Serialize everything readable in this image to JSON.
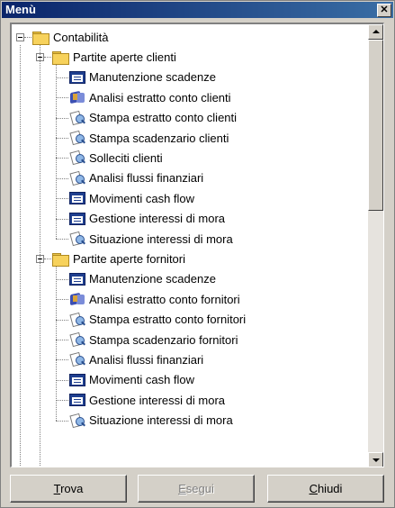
{
  "window": {
    "title": "Menù",
    "close_glyph": "✕"
  },
  "tree": {
    "root": {
      "label": "Contabilità",
      "icon": "folder-icon"
    },
    "groups": [
      {
        "label": "Partite aperte clienti",
        "icon": "folder-icon",
        "items": [
          {
            "label": "Manutenzione scadenze",
            "icon": "form-icon"
          },
          {
            "label": "Analisi estratto conto clienti",
            "icon": "book-icon"
          },
          {
            "label": "Stampa estratto conto clienti",
            "icon": "report-icon"
          },
          {
            "label": "Stampa scadenzario clienti",
            "icon": "report-icon"
          },
          {
            "label": "Solleciti clienti",
            "icon": "report-icon"
          },
          {
            "label": "Analisi flussi finanziari",
            "icon": "report-icon"
          },
          {
            "label": "Movimenti cash flow",
            "icon": "form-icon"
          },
          {
            "label": "Gestione interessi di mora",
            "icon": "form-icon"
          },
          {
            "label": "Situazione interessi di mora",
            "icon": "report-icon"
          }
        ]
      },
      {
        "label": "Partite aperte fornitori",
        "icon": "folder-icon",
        "items": [
          {
            "label": "Manutenzione scadenze",
            "icon": "form-icon"
          },
          {
            "label": "Analisi estratto conto fornitori",
            "icon": "book-icon"
          },
          {
            "label": "Stampa estratto conto fornitori",
            "icon": "report-icon"
          },
          {
            "label": "Stampa scadenzario fornitori",
            "icon": "report-icon"
          },
          {
            "label": "Analisi flussi finanziari",
            "icon": "report-icon"
          },
          {
            "label": "Movimenti cash flow",
            "icon": "form-icon"
          },
          {
            "label": "Gestione interessi di mora",
            "icon": "form-icon"
          },
          {
            "label": "Situazione interessi di mora",
            "icon": "report-icon"
          }
        ]
      }
    ]
  },
  "buttons": {
    "trova": {
      "label_first": "T",
      "label_rest": "rova"
    },
    "esegui": {
      "label_first": "E",
      "label_rest": "segui",
      "disabled": true
    },
    "chiudi": {
      "label_first": "C",
      "label_rest": "hiudi"
    }
  }
}
